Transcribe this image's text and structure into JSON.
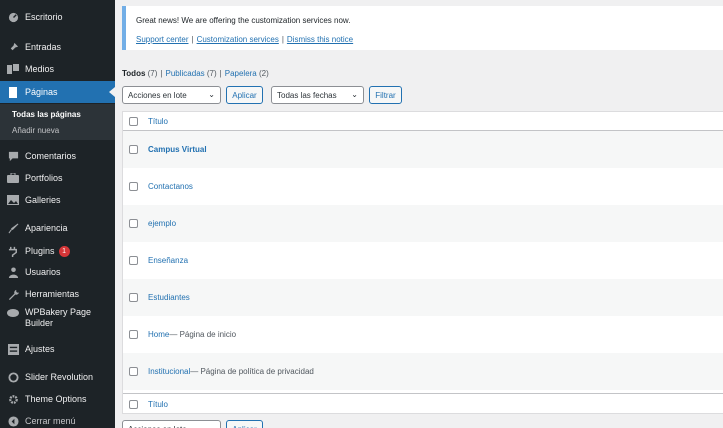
{
  "sidebar": {
    "items": [
      {
        "label": "Escritorio",
        "icon": "dashboard-icon"
      },
      {
        "label": "Entradas",
        "icon": "pin-icon"
      },
      {
        "label": "Medios",
        "icon": "media-icon"
      },
      {
        "label": "Páginas",
        "icon": "page-icon"
      },
      {
        "label": "Comentarios",
        "icon": "comment-icon"
      },
      {
        "label": "Portfolios",
        "icon": "portfolio-icon"
      },
      {
        "label": "Galleries",
        "icon": "gallery-icon"
      },
      {
        "label": "Apariencia",
        "icon": "brush-icon"
      },
      {
        "label": "Plugins",
        "icon": "plugin-icon",
        "badge": "1"
      },
      {
        "label": "Usuarios",
        "icon": "users-icon"
      },
      {
        "label": "Herramientas",
        "icon": "wrench-icon"
      },
      {
        "label": "WPBakery Page Builder",
        "icon": "wpbakery-icon"
      },
      {
        "label": "Ajustes",
        "icon": "settings-icon"
      },
      {
        "label": "Slider Revolution",
        "icon": "slider-revolution-icon"
      },
      {
        "label": "Theme Options",
        "icon": "gear-icon"
      },
      {
        "label": "Cerrar menú",
        "icon": "collapse-icon"
      }
    ],
    "submenu": [
      {
        "label": "Todas las páginas"
      },
      {
        "label": "Añadir nueva"
      }
    ]
  },
  "notice": {
    "message": "Great news! We are offering the customization services now.",
    "links": [
      "Support center",
      "Customization services",
      "Dismiss this notice"
    ]
  },
  "views": {
    "all": {
      "label": "Todos",
      "count": "(7)"
    },
    "published": {
      "label": "Publicadas",
      "count": "(7)"
    },
    "trash": {
      "label": "Papelera",
      "count": "(2)"
    }
  },
  "filters": {
    "bulk_actions": "Acciones en lote",
    "apply": "Aplicar",
    "dates": "Todas las fechas",
    "filter": "Filtrar"
  },
  "table": {
    "column_title": "Título",
    "rows": [
      {
        "title": "Campus Virtual",
        "state": ""
      },
      {
        "title": "Contactanos",
        "state": ""
      },
      {
        "title": "ejemplo",
        "state": ""
      },
      {
        "title": "Enseñanza",
        "state": ""
      },
      {
        "title": "Estudiantes",
        "state": ""
      },
      {
        "title": "Home",
        "state": " — Página de inicio"
      },
      {
        "title": "Institucional",
        "state": " — Página de política de privacidad"
      }
    ]
  },
  "colors": {
    "sidebar_bg": "#1d2327",
    "accent": "#2271b1",
    "badge": "#d63638",
    "notice_border": "#72aee6"
  }
}
